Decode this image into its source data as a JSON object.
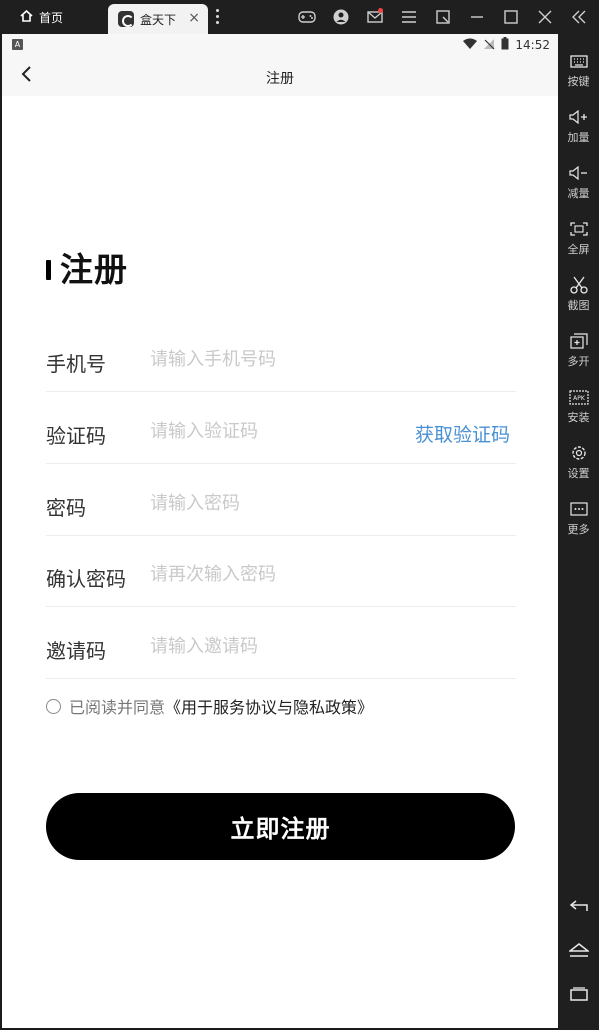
{
  "titlebar": {
    "home_tab_label": "首页",
    "app_tab_label": "盒天下",
    "icons": [
      "gamepad-icon",
      "user-avatar-icon",
      "mail-icon",
      "menu-icon",
      "restore-icon",
      "minimize-icon",
      "maximize-icon",
      "close-icon",
      "collapse-icon"
    ]
  },
  "sidebar": {
    "items": [
      {
        "label": "按键",
        "icon": "keyboard-icon"
      },
      {
        "label": "加量",
        "icon": "volume-up-icon"
      },
      {
        "label": "减量",
        "icon": "volume-down-icon"
      },
      {
        "label": "全屏",
        "icon": "fullscreen-icon"
      },
      {
        "label": "截图",
        "icon": "scissors-icon"
      },
      {
        "label": "多开",
        "icon": "multi-instance-icon"
      },
      {
        "label": "安装",
        "icon": "apk-install-icon"
      },
      {
        "label": "设置",
        "icon": "gear-icon"
      },
      {
        "label": "更多",
        "icon": "more-icon"
      }
    ],
    "nav": [
      "back-icon",
      "home-icon",
      "recents-icon"
    ]
  },
  "statusbar": {
    "time": "14:52"
  },
  "navbar": {
    "title": "注册"
  },
  "form": {
    "heading": "注册",
    "fields": [
      {
        "label": "手机号",
        "placeholder": "请输入手机号码"
      },
      {
        "label": "验证码",
        "placeholder": "请输入验证码",
        "action": "获取验证码"
      },
      {
        "label": "密码",
        "placeholder": "请输入密码"
      },
      {
        "label": "确认密码",
        "placeholder": "请再次输入密码"
      },
      {
        "label": "邀请码",
        "placeholder": "请输入邀请码"
      }
    ],
    "agree_prefix": "已阅读并同意",
    "agree_link": "《用于服务协议与隐私政策》",
    "submit_label": "立即注册"
  },
  "colors": {
    "accent_link": "#4a90d6",
    "button_bg": "#000000",
    "chrome_bg": "#1f1f1f"
  }
}
